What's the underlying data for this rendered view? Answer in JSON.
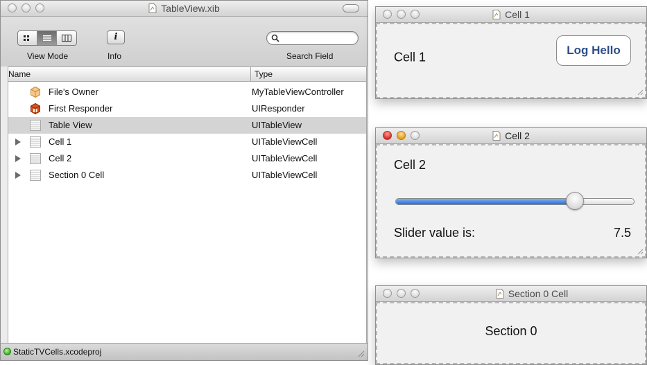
{
  "main_window": {
    "title": "TableView.xib",
    "toolbar": {
      "view_mode_label": "View Mode",
      "info_label": "Info",
      "info_glyph": "i",
      "search_label": "Search Field",
      "search_value": "",
      "selected_view_mode": "list"
    },
    "table": {
      "columns": [
        "Name",
        "Type"
      ],
      "rows": [
        {
          "name": "File's Owner",
          "type": "MyTableViewController",
          "icon": "cube-icon",
          "expandable": false,
          "selected": false
        },
        {
          "name": "First Responder",
          "type": "UIResponder",
          "icon": "responder-icon",
          "expandable": false,
          "selected": false
        },
        {
          "name": "Table View",
          "type": "UITableView",
          "icon": "tableview-icon",
          "expandable": false,
          "selected": true
        },
        {
          "name": "Cell 1",
          "type": "UITableViewCell",
          "icon": "tableview-icon",
          "expandable": true,
          "selected": false
        },
        {
          "name": "Cell 2",
          "type": "UITableViewCell",
          "icon": "tableview-icon",
          "expandable": true,
          "selected": false
        },
        {
          "name": "Section 0 Cell",
          "type": "UITableViewCell",
          "icon": "tableview-icon",
          "expandable": true,
          "selected": false
        }
      ]
    },
    "status": {
      "project": "StaticTVCells.xcodeproj",
      "indicator_color": "#36b020"
    }
  },
  "cell1_window": {
    "title": "Cell 1",
    "label": "Cell 1",
    "button_label": "Log Hello"
  },
  "cell2_window": {
    "title": "Cell 2",
    "label": "Cell 2",
    "slider_fraction": 0.75,
    "value_label": "Slider value is:",
    "value": "7.5"
  },
  "section_window": {
    "title": "Section 0 Cell",
    "label": "Section 0"
  },
  "colors": {
    "button_text": "#2c4d89",
    "slider_fill": "#2c6ed6",
    "selected_row": "#d4d4d4"
  }
}
